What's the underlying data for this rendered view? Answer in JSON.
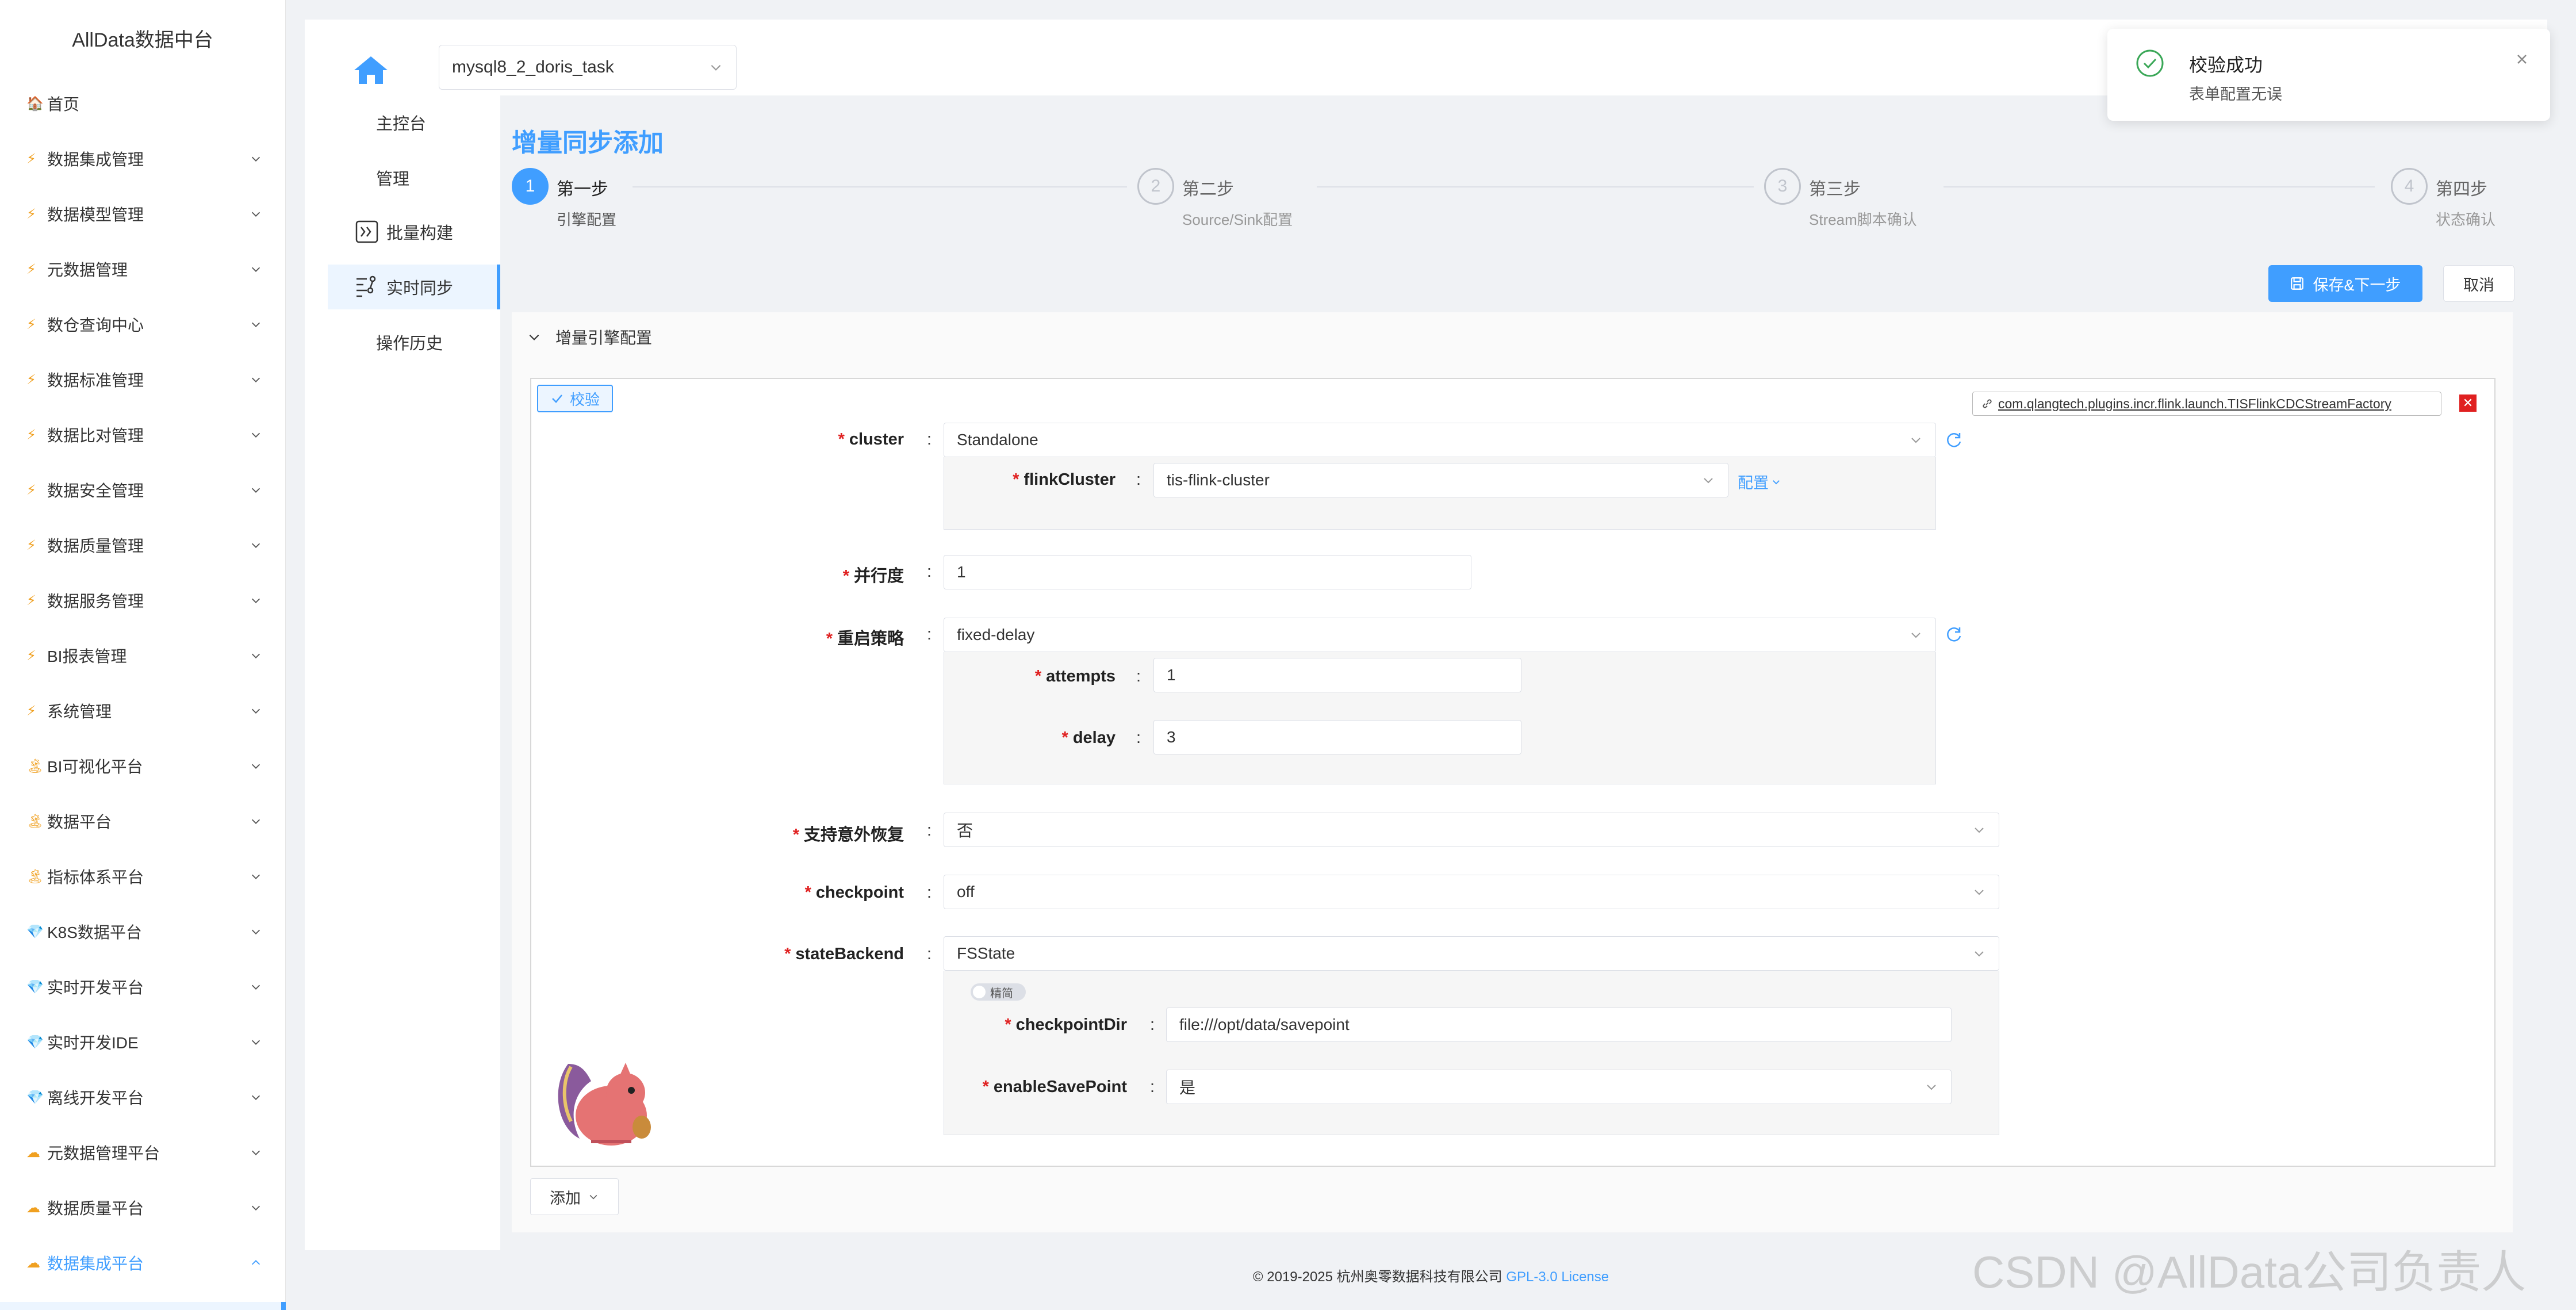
{
  "app_title": "AllData数据中台",
  "sidebar": {
    "items": [
      {
        "label": "首页",
        "icon": "🏠",
        "icon_name": "house-icon",
        "expandable": false
      },
      {
        "label": "数据集成管理",
        "icon": "⚡",
        "icon_name": "lightning-icon",
        "expandable": true
      },
      {
        "label": "数据模型管理",
        "icon": "⚡",
        "icon_name": "lightning-icon",
        "expandable": true
      },
      {
        "label": "元数据管理",
        "icon": "⚡",
        "icon_name": "lightning-icon",
        "expandable": true
      },
      {
        "label": "数仓查询中心",
        "icon": "⚡",
        "icon_name": "lightning-icon",
        "expandable": true
      },
      {
        "label": "数据标准管理",
        "icon": "⚡",
        "icon_name": "lightning-icon",
        "expandable": true
      },
      {
        "label": "数据比对管理",
        "icon": "⚡",
        "icon_name": "lightning-icon",
        "expandable": true
      },
      {
        "label": "数据安全管理",
        "icon": "⚡",
        "icon_name": "lightning-icon",
        "expandable": true
      },
      {
        "label": "数据质量管理",
        "icon": "⚡",
        "icon_name": "lightning-icon",
        "expandable": true
      },
      {
        "label": "数据服务管理",
        "icon": "⚡",
        "icon_name": "lightning-icon",
        "expandable": true
      },
      {
        "label": "BI报表管理",
        "icon": "⚡",
        "icon_name": "lightning-icon",
        "expandable": true
      },
      {
        "label": "系统管理",
        "icon": "⚡",
        "icon_name": "lightning-icon",
        "expandable": true
      },
      {
        "label": "BI可视化平台",
        "icon": "🏝",
        "icon_name": "island-icon",
        "expandable": true
      },
      {
        "label": "数据平台",
        "icon": "🏝",
        "icon_name": "island-icon",
        "expandable": true
      },
      {
        "label": "指标体系平台",
        "icon": "🏝",
        "icon_name": "island-icon",
        "expandable": true
      },
      {
        "label": "K8S数据平台",
        "icon": "💎",
        "icon_name": "gem-icon",
        "expandable": true
      },
      {
        "label": "实时开发平台",
        "icon": "💎",
        "icon_name": "gem-icon",
        "expandable": true
      },
      {
        "label": "实时开发IDE",
        "icon": "💎",
        "icon_name": "gem-icon",
        "expandable": true
      },
      {
        "label": "离线开发平台",
        "icon": "💎",
        "icon_name": "gem-icon",
        "expandable": true
      },
      {
        "label": "元数据管理平台",
        "icon": "☁",
        "icon_name": "cloud-icon",
        "expandable": true
      },
      {
        "label": "数据质量平台",
        "icon": "☁",
        "icon_name": "cloud-icon",
        "expandable": true
      },
      {
        "label": "数据集成平台",
        "icon": "☁",
        "icon_name": "cloud-icon",
        "expandable": true,
        "active": true
      }
    ]
  },
  "header": {
    "task_select_value": "mysql8_2_doris_task"
  },
  "subnav": {
    "items": [
      {
        "label": "主控台",
        "icon_name": ""
      },
      {
        "label": "管理",
        "icon_name": ""
      },
      {
        "label": "批量构建",
        "icon_name": "batch-build-icon"
      },
      {
        "label": "实时同步",
        "icon_name": "realtime-sync-icon",
        "active": true
      },
      {
        "label": "操作历史",
        "icon_name": ""
      }
    ]
  },
  "page": {
    "heading": "增量同步添加",
    "steps": [
      {
        "num": "1",
        "title": "第一步",
        "desc": "引擎配置",
        "active": true
      },
      {
        "num": "2",
        "title": "第二步",
        "desc": "Source/Sink配置",
        "active": false
      },
      {
        "num": "3",
        "title": "第三步",
        "desc": "Stream脚本确认",
        "active": false
      },
      {
        "num": "4",
        "title": "第四步",
        "desc": "状态确认",
        "active": false
      }
    ],
    "save_next_label": "保存&下一步",
    "cancel_label": "取消",
    "collapse_title": "增量引擎配置",
    "verify_label": "校验",
    "plugin_class": "com.qlangtech.plugins.incr.flink.launch.TISFlinkCDCStreamFactory",
    "add_label": "添加"
  },
  "form": {
    "cluster": {
      "label": "cluster",
      "value": "Standalone"
    },
    "flinkCluster": {
      "label": "flinkCluster",
      "value": "tis-flink-cluster",
      "config_link": "配置"
    },
    "parallelism": {
      "label": "并行度",
      "value": "1"
    },
    "restart": {
      "label": "重启策略",
      "value": "fixed-delay"
    },
    "attempts": {
      "label": "attempts",
      "value": "1"
    },
    "delay": {
      "label": "delay",
      "value": "3"
    },
    "recover": {
      "label": "支持意外恢复",
      "value": "否"
    },
    "checkpoint": {
      "label": "checkpoint",
      "value": "off"
    },
    "stateBackend": {
      "label": "stateBackend",
      "value": "FSState"
    },
    "toggle_label": "精简",
    "checkpointDir": {
      "label": "checkpointDir",
      "value": "file:///opt/data/savepoint"
    },
    "enableSavePoint": {
      "label": "enableSavePoint",
      "value": "是"
    }
  },
  "toast": {
    "title": "校验成功",
    "message": "表单配置无误"
  },
  "footer": {
    "text": "© 2019-2025 杭州奥零数据科技有限公司",
    "license": "GPL-3.0 License"
  },
  "watermark": "CSDN @AllData公司负责人",
  "colors": {
    "primary": "#409eff",
    "danger": "#e02020",
    "success": "#3aa757"
  }
}
